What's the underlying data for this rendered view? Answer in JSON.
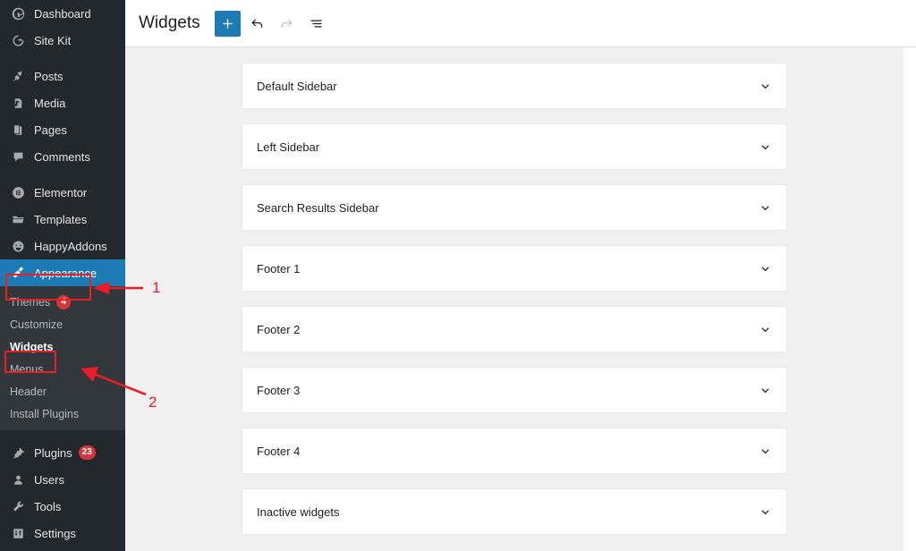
{
  "sidebar": {
    "items": [
      {
        "label": "Dashboard",
        "icon": "dashboard-icon",
        "gap_after": false
      },
      {
        "label": "Site Kit",
        "icon": "sitekit-g-icon",
        "gap_after": true
      },
      {
        "label": "Posts",
        "icon": "pin-icon",
        "gap_after": false
      },
      {
        "label": "Media",
        "icon": "media-icon",
        "gap_after": false
      },
      {
        "label": "Pages",
        "icon": "pages-icon",
        "gap_after": false
      },
      {
        "label": "Comments",
        "icon": "comment-icon",
        "gap_after": true
      },
      {
        "label": "Elementor",
        "icon": "elementor-icon",
        "gap_after": false
      },
      {
        "label": "Templates",
        "icon": "folder-icon",
        "gap_after": false
      },
      {
        "label": "HappyAddons",
        "icon": "smiley-icon",
        "gap_after": false
      }
    ],
    "appearance": {
      "label": "Appearance",
      "icon": "paintbrush-icon",
      "active": true
    },
    "submenu": [
      {
        "label": "Themes",
        "badge": "4",
        "current": false
      },
      {
        "label": "Customize",
        "badge": "",
        "current": false
      },
      {
        "label": "Widgets",
        "badge": "",
        "current": true
      },
      {
        "label": "Menus",
        "badge": "",
        "current": false
      },
      {
        "label": "Header",
        "badge": "",
        "current": false
      },
      {
        "label": "Install Plugins",
        "badge": "",
        "current": false
      }
    ],
    "bottom_items": [
      {
        "label": "Plugins",
        "icon": "plug-icon",
        "badge": "23"
      },
      {
        "label": "Users",
        "icon": "user-icon",
        "badge": ""
      },
      {
        "label": "Tools",
        "icon": "wrench-icon",
        "badge": ""
      },
      {
        "label": "Settings",
        "icon": "sliders-icon",
        "badge": ""
      }
    ]
  },
  "topbar": {
    "title": "Widgets",
    "add_block_label": "+",
    "undo_name": "undo-icon",
    "redo_name": "redo-icon",
    "list_view_name": "list-view-icon"
  },
  "widget_areas": [
    {
      "name": "Default Sidebar"
    },
    {
      "name": "Left Sidebar"
    },
    {
      "name": "Search Results Sidebar"
    },
    {
      "name": "Footer 1"
    },
    {
      "name": "Footer 2"
    },
    {
      "name": "Footer 3"
    },
    {
      "name": "Footer 4"
    },
    {
      "name": "Inactive widgets"
    }
  ],
  "annotations": {
    "marker_one": "1",
    "marker_two": "2"
  },
  "colors": {
    "sidebar_bg": "#23282d",
    "submenu_bg": "#32373c",
    "accent_blue": "#1c7bb5",
    "annotation_red": "#ee1c25",
    "badge_red": "#d63638",
    "content_bg": "#f0f0f0"
  }
}
